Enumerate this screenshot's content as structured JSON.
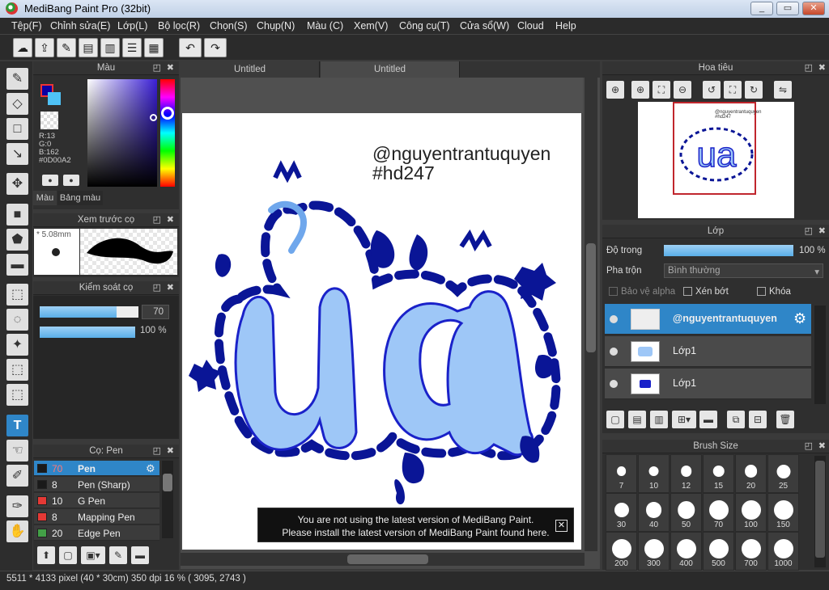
{
  "window": {
    "title": "MediBang Paint Pro (32bit)",
    "min": "_",
    "max": "▭",
    "close": "✕"
  },
  "menu": [
    "Tệp(F)",
    "Chỉnh sửa(E)",
    "Lớp(L)",
    "Bộ lọc(R)",
    "Chọn(S)",
    "Chụp(N)",
    "Màu (C)",
    "Xem(V)",
    "Công cụ(T)",
    "Cửa sổ(W)",
    "Cloud",
    "Help"
  ],
  "toolbar": {
    "undo": "↶",
    "redo": "↷"
  },
  "color_panel": {
    "title": "Màu",
    "foreground": "#0D00A2",
    "background": "#4FC3F7",
    "r": "R:13",
    "g": "G:0",
    "b": "B:162",
    "hex": "#0D00A2",
    "tab_color": "Màu",
    "tab_palette": "Bảng màu"
  },
  "brush_preview": {
    "title": "Xem trước cọ",
    "size": "* 5.08mm"
  },
  "brush_control": {
    "title": "Kiểm soát cọ",
    "size_value": "70",
    "opacity_value": "100 %",
    "size_fraction": 0.78,
    "opacity_fraction": 1.0
  },
  "brush_list": {
    "title": "Cọ: Pen",
    "items": [
      {
        "num": "70",
        "name": "Pen",
        "color": "#1a1a1a"
      },
      {
        "num": "8",
        "name": "Pen (Sharp)",
        "color": "#1a1a1a"
      },
      {
        "num": "10",
        "name": "G Pen",
        "color": "#e53935"
      },
      {
        "num": "8",
        "name": "Mapping Pen",
        "color": "#e53935"
      },
      {
        "num": "20",
        "name": "Edge Pen",
        "color": "#43a047"
      }
    ]
  },
  "tabs": [
    "Untitled",
    "Untitled"
  ],
  "canvas": {
    "line1": "@nguyentrantuquyen",
    "line2": "#hd247"
  },
  "notice": {
    "line1": "You are not using the latest version of MediBang Paint.",
    "line2": "Please install the latest version of MediBang Paint found here.",
    "close": "✕"
  },
  "navigator": {
    "title": "Hoa tiêu",
    "preview_line1": "@nguyentrantuquyen",
    "preview_line2": "#hd247"
  },
  "layers": {
    "title": "Lớp",
    "opacity_label": "Độ trong",
    "opacity_value": "100 %",
    "blend_label": "Pha trộn",
    "blend_value": "Bình thường",
    "protect_alpha": "Bảo vệ alpha",
    "clipping": "Xén bớt",
    "lock": "Khóa",
    "items": [
      {
        "name": "@nguyentrantuquyen",
        "selected": true
      },
      {
        "name": "Lớp1",
        "selected": false
      },
      {
        "name": "Lớp1",
        "selected": false
      }
    ]
  },
  "brush_size": {
    "title": "Brush Size",
    "sizes": [
      "7",
      "10",
      "12",
      "15",
      "20",
      "25",
      "30",
      "40",
      "50",
      "70",
      "100",
      "150",
      "200",
      "300",
      "400",
      "500",
      "700",
      "1000"
    ]
  },
  "status": "5511 * 4133 pixel  (40 * 30cm)  350 dpi  16 %  ( 3095, 2743 )"
}
